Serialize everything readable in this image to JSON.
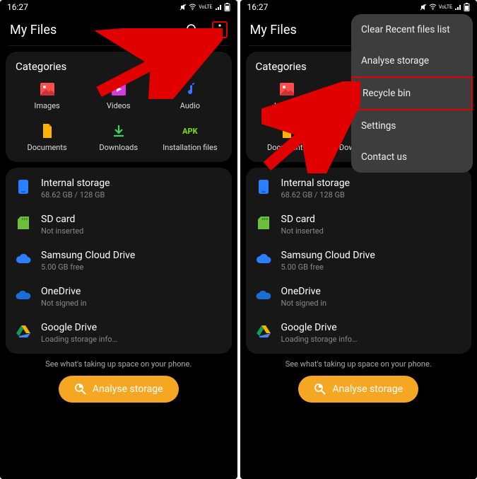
{
  "status": {
    "time": "16:27"
  },
  "header": {
    "title": "My Files"
  },
  "categories": {
    "title": "Categories",
    "items": [
      {
        "label": "Images"
      },
      {
        "label": "Videos"
      },
      {
        "label": "Audio"
      },
      {
        "label": "Documents"
      },
      {
        "label": "Downloads"
      },
      {
        "label": "Installation files"
      }
    ]
  },
  "storage": [
    {
      "name": "Internal storage",
      "sub": "68.62 GB / 128 GB"
    },
    {
      "name": "SD card",
      "sub": "Not inserted"
    },
    {
      "name": "Samsung Cloud Drive",
      "sub": "5.00 GB free"
    },
    {
      "name": "OneDrive",
      "sub": "Not signed in"
    },
    {
      "name": "Google Drive",
      "sub": "Loading storage info…"
    }
  ],
  "footer": {
    "hint": "See what's taking up space on your phone.",
    "button": "Analyse storage"
  },
  "menu": {
    "items": [
      "Clear Recent files list",
      "Analyse storage",
      "Recycle bin",
      "Settings",
      "Contact us"
    ]
  },
  "colors": {
    "accent": "#f5a623",
    "highlight": "#e00000",
    "video": "#d63cdd",
    "audio": "#3b74ff",
    "doc": "#ffb300",
    "down": "#3bd45a",
    "apk": "#7bd600",
    "internal": "#2b7fff",
    "sd": "#6bbf3a",
    "cloud": "#2b7fff",
    "onedrive": "#1a6fd6",
    "gdrive": "#f4b400",
    "image": "#ff4d4d"
  }
}
